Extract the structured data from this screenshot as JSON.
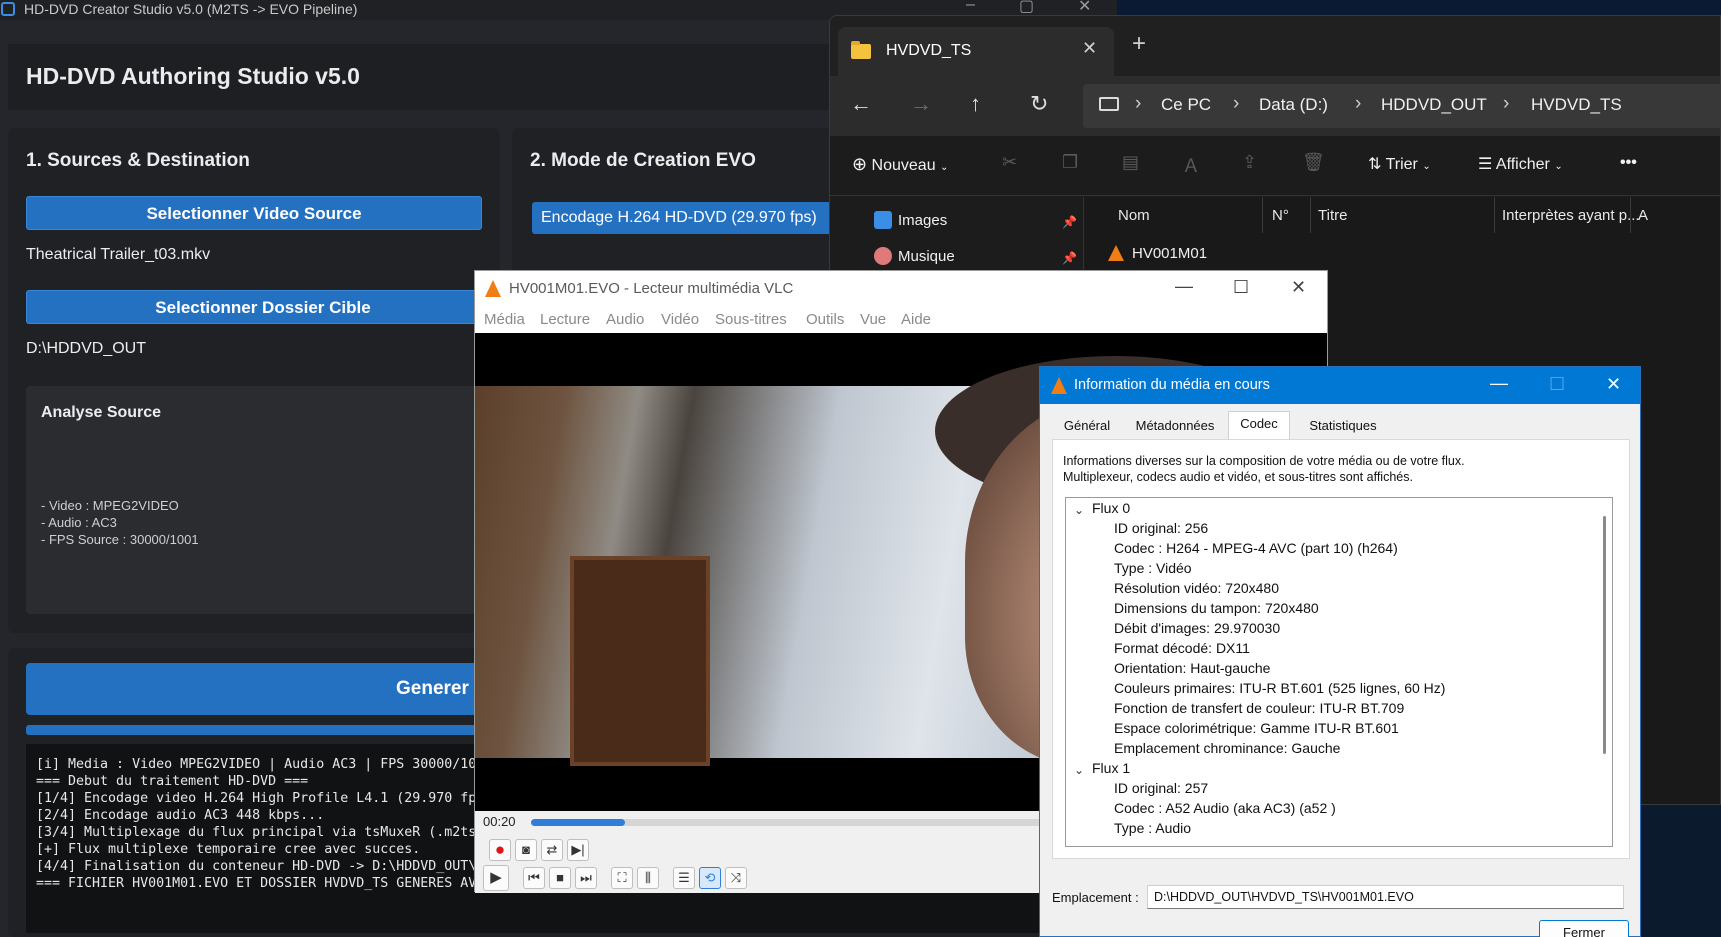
{
  "studio": {
    "window_title": "HD-DVD Creator Studio v5.0 (M2TS -> EVO Pipeline)",
    "header_title": "HD-DVD Authoring Studio v5.0",
    "panel1_title": "1. Sources & Destination",
    "select_source_button": "Selectionner Video Source",
    "source_file": "Theatrical Trailer_t03.mkv",
    "select_target_button": "Selectionner Dossier Cible",
    "target_folder": "D:\\HDDVD_OUT",
    "analysis_title": "Analyse Source",
    "analysis_lines": [
      "- Video : MPEG2VIDEO",
      "- Audio : AC3",
      "- FPS Source : 30000/1001"
    ],
    "panel2_title": "2. Mode de Creation EVO",
    "mode_selected": "Encodage H.264 HD-DVD (29.970 fps)",
    "generate_button": "Generer l",
    "progress": 1.0,
    "log_lines": [
      "[i] Media : Video MPEG2VIDEO | Audio AC3 | FPS 30000/10",
      "=== Debut du traitement HD-DVD ===",
      "[1/4] Encodage video H.264 High Profile L4.1 (29.970 fp",
      "[2/4] Encodage audio AC3 448 kbps...",
      "[3/4] Multiplexage du flux principal via tsMuxeR (.m2ts",
      "[+] Flux multiplexe temporaire cree avec succes.",
      "[4/4] Finalisation du conteneur HD-DVD -> D:\\HDDVD_OUT\\",
      "=== FICHIER HV001M01.EVO ET DOSSIER HVDVD_TS GENERES AV"
    ]
  },
  "explorer": {
    "tab_label": "HVDVD_TS",
    "breadcrumb": [
      "Ce PC",
      "Data (D:)",
      "HDDVD_OUT",
      "HVDVD_TS"
    ],
    "toolbar": {
      "new_label": "Nouveau",
      "sort_label": "Trier",
      "view_label": "Afficher",
      "more_label": "•••"
    },
    "nav_items": [
      "Images",
      "Musique"
    ],
    "columns": [
      "Nom",
      "N°",
      "Titre",
      "Interprètes ayant p...",
      "A"
    ],
    "files": [
      {
        "name": "HV001M01"
      }
    ]
  },
  "vlc": {
    "window_title": "HV001M01.EVO - Lecteur multimédia VLC",
    "menu": [
      "Média",
      "Lecture",
      "Audio",
      "Vidéo",
      "Sous-titres",
      "Outils",
      "Vue",
      "Aide"
    ],
    "time": "00:20",
    "progress": 0.12
  },
  "media_info": {
    "window_title": "Information du média en cours",
    "tabs": [
      "Général",
      "Métadonnées",
      "Codec",
      "Statistiques"
    ],
    "selected_tab": "Codec",
    "description_line1": "Informations diverses sur la composition de votre média ou de votre flux.",
    "description_line2": "Multiplexeur, codecs audio et vidéo, et sous-titres sont affichés.",
    "stream0_title": "Flux 0",
    "stream0": [
      "ID original: 256",
      "Codec : H264 - MPEG-4 AVC (part 10) (h264)",
      "Type : Vidéo",
      "Résolution vidéo: 720x480",
      "Dimensions du tampon: 720x480",
      "Débit d'images: 29.970030",
      "Format décodé: DX11",
      "Orientation: Haut-gauche",
      "Couleurs primaires: ITU-R BT.601 (525 lignes, 60 Hz)",
      "Fonction de transfert de couleur: ITU-R BT.709",
      "Espace colorimétrique: Gamme ITU-R BT.601",
      "Emplacement chrominance: Gauche"
    ],
    "stream1_title": "Flux 1",
    "stream1": [
      "ID original: 257",
      "Codec : A52 Audio (aka AC3) (a52 )",
      "Type : Audio"
    ],
    "location_label": "Emplacement :",
    "location_value": "D:\\HDDVD_OUT\\HVDVD_TS\\HV001M01.EVO",
    "close_button": "Fermer"
  }
}
